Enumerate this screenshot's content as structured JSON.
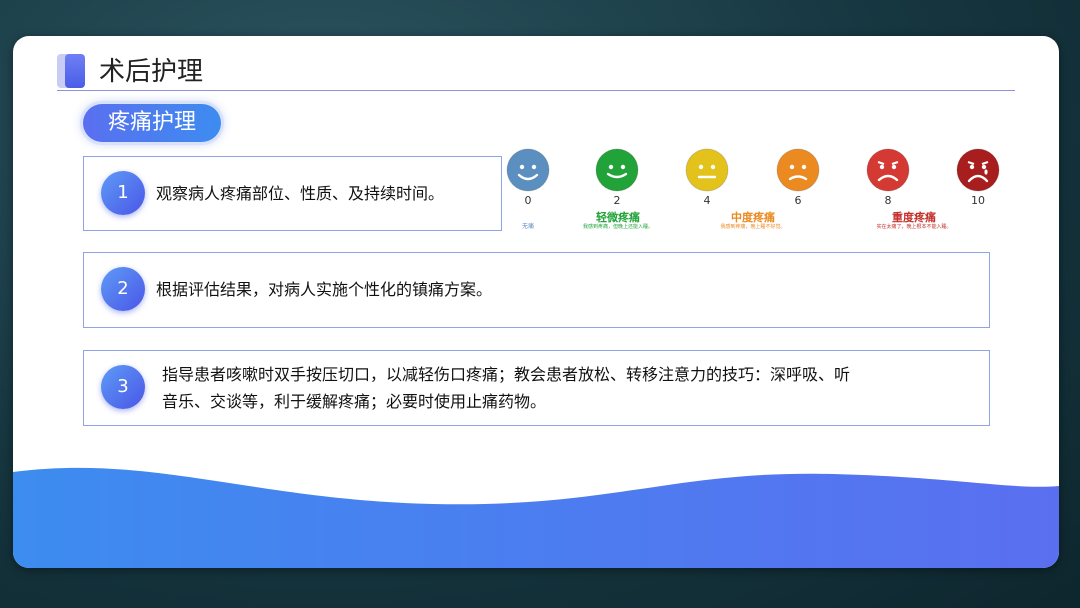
{
  "slide": {
    "title": "术后护理",
    "section_pill": "疼痛护理"
  },
  "items": [
    {
      "number": "1",
      "text": "观察病人疼痛部位、性质、及持续时间。"
    },
    {
      "number": "2",
      "text": "根据评估结果，对病人实施个性化的镇痛方案。"
    },
    {
      "number": "3",
      "text": "指导患者咳嗽时双手按压切口，以减轻伤口疼痛；教会患者放松、转移注意力的技巧：深呼吸、听音乐、交谈等，利于缓解疼痛；必要时使用止痛药物。"
    }
  ],
  "pain_scale": {
    "numbers": [
      "0",
      "2",
      "4",
      "6",
      "8",
      "10"
    ],
    "face_colors": [
      "#5b8fc0",
      "#22a33a",
      "#e3c21c",
      "#ec8a22",
      "#d43a33",
      "#a81d1d"
    ],
    "labels": [
      {
        "text": "无痛",
        "color": "#5b8fc0"
      },
      {
        "text": "轻微疼痛",
        "color": "#22a33a",
        "desc": "我感到疼痛，但晚上还能入睡。"
      },
      {
        "text": "中度疼痛",
        "color": "#ec8a22",
        "desc": "我感到疼痛，晚上睡不好觉。"
      },
      {
        "text": "重度疼痛",
        "color": "#c4302b",
        "desc": "实在太痛了，晚上根本不能入睡。"
      }
    ]
  },
  "colors": {
    "accent": "#4a5ee8",
    "wave_start": "#3d8cf0",
    "wave_end": "#5a6ff0"
  }
}
